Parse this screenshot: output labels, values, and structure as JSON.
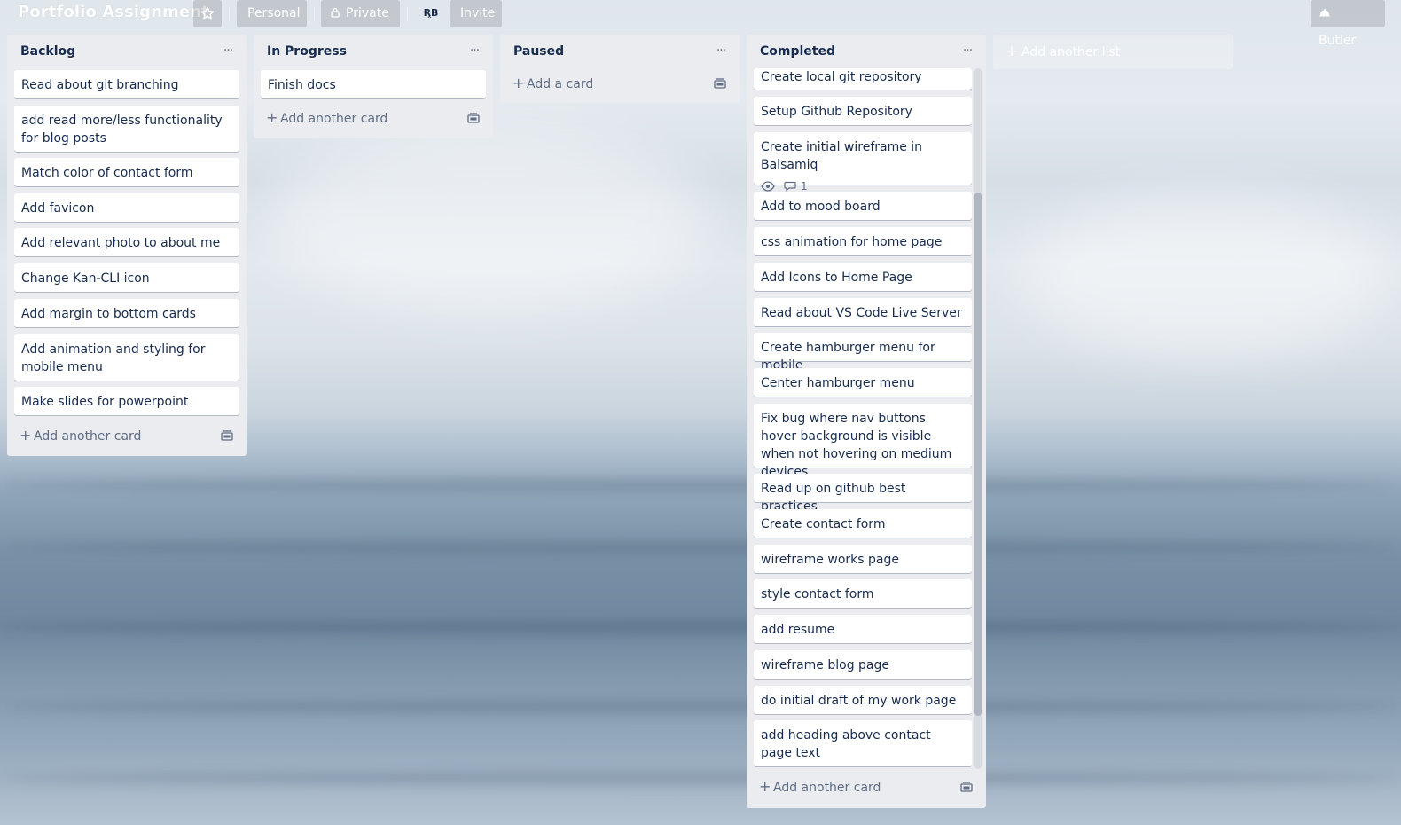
{
  "header": {
    "board_title": "Portfolio Assignment",
    "workspace": "Personal",
    "visibility": "Private",
    "member_initials": "RB",
    "invite_label": "Invite",
    "butler_label": "Butler"
  },
  "lists": {
    "backlog": {
      "title": "Backlog",
      "cards": [
        "Read about git branching",
        "add read more/less functionality for blog posts",
        "Match color of contact form",
        "Add favicon",
        "Add relevant photo to about me",
        "Change Kan-CLI icon",
        "Add margin to bottom cards",
        "Add animation and styling for mobile menu",
        "Make slides for powerpoint"
      ],
      "add_label": "Add another card"
    },
    "in_progress": {
      "title": "In Progress",
      "cards": [
        "Finish docs"
      ],
      "add_label": "Add another card"
    },
    "paused": {
      "title": "Paused",
      "cards": [],
      "add_label": "Add a card"
    },
    "completed": {
      "title": "Completed",
      "cards": [
        "Create local git repository",
        "Setup Github Repository",
        "Create initial wireframe in Balsamiq",
        "Add to mood board",
        "css animation for home page",
        "Add Icons to Home Page",
        "Read about VS Code Live Server",
        "Create hamburger menu for mobile",
        "Center hamburger menu",
        "Fix bug where nav buttons hover background is visible when not hovering on medium devices",
        "Read up on github best practices",
        "Create contact form",
        "wireframe works page",
        "style contact form",
        "add resume",
        "wireframe blog page",
        "do initial draft of my work page",
        "add heading above contact page text"
      ],
      "balsamiq_comment_count": "1",
      "add_label": "Add another card"
    }
  },
  "add_list_label": "Add another list",
  "icons": {
    "star": "star-icon",
    "lock": "lock-icon",
    "butler": "butler-icon",
    "list_menu": "ellipsis-icon",
    "plus": "plus-icon",
    "template": "card-template-icon",
    "watch": "eye-icon",
    "comment": "comment-icon"
  }
}
